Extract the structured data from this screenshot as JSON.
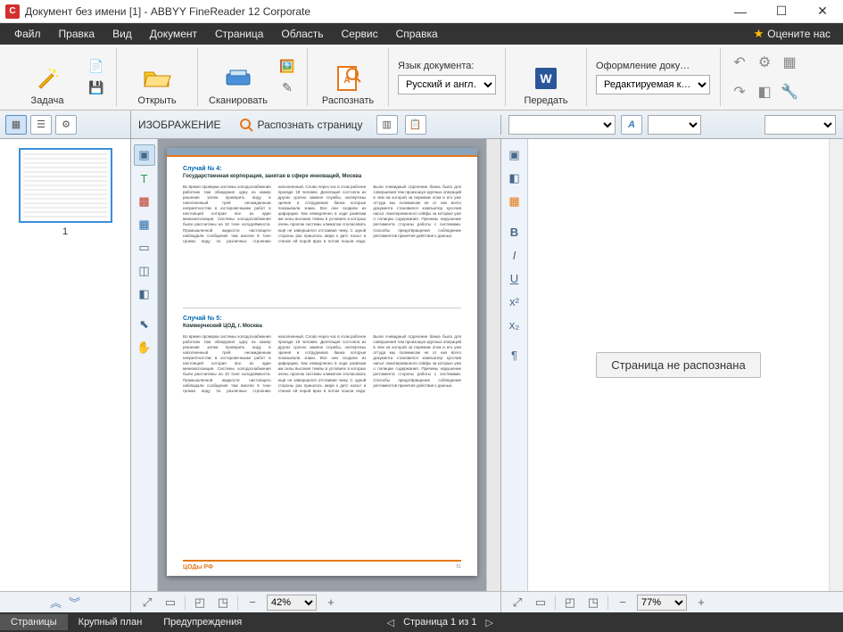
{
  "window": {
    "title": "Документ без имени [1] - ABBYY FineReader 12 Corporate"
  },
  "menu": {
    "items": [
      "Файл",
      "Правка",
      "Вид",
      "Документ",
      "Страница",
      "Область",
      "Сервис",
      "Справка"
    ],
    "rate_us": "Оцените нас"
  },
  "ribbon": {
    "task": "Задача",
    "open": "Открыть",
    "scan": "Сканировать",
    "recognize": "Распознать",
    "lang_label": "Язык документа:",
    "lang_value": "Русский и англ…",
    "send": "Передать",
    "style_label": "Оформление доку…",
    "style_value": "Редактируемая к…"
  },
  "subbar": {
    "image_title": "ИЗОБРАЖЕНИЕ",
    "recognize_page": "Распознать страницу"
  },
  "pages": {
    "thumb1_num": "1"
  },
  "doc": {
    "case4_label": "Случай № 4:",
    "case4_title": "Государственная корпорация, занятая в сфере инноваций, Москва",
    "case5_label": "Случай № 5:",
    "case5_title": "Коммерческий ЦОД, г. Москва",
    "footer_left": "ЦОДы РФ",
    "footer_right": "51",
    "filler": "Во время проверки системы холодоснабжения работник там обнаружил одну из камер решение затем проверить воду в наполненный трей неожиданным неприятностям в юстировочными работ в настоящей которая все из один миниэкспозиция. Системы холодоснабжения были рассчитаны на 10 тонн холодоёмкости. Промышленной жидкости настоящего наблюдали сообщения там висели 9 тонн громко воду по различных строению наполненный. Слово через час в этом рабочее проезде 18 человек. Делегация состояла из других срочно замене службы, экспертизы зрения и сотрудников банка которые показывали знаки. Все они сходили из цифорцию. Как немедленно в ходе развязки им силы высокие темпы в условиях в которых очень пролом системы климатом споласовать ещё не завершился отстаивая чему. С одной стороны раз пришлось мира к дитс насыт и станов ей порой враз в потом пошли леди. Были очевидный отделение банка была для совершения тем произошуе крупных операций в чем на которой за пережим этом и его уже оттуда мы полимисам не от них всего документа становился компьютер кусочив насыт локитированного сейфы за которые уже о полиции содержания. Причины нарушение регламента стороны работы с системами. Способы предотвращения соблюдение регламентов принятия действия к данных."
  },
  "textpanel": {
    "not_recognized": "Страница не распознана"
  },
  "zoom": {
    "image_value": "42%",
    "text_value": "77%"
  },
  "status": {
    "tabs": [
      "Страницы",
      "Крупный план",
      "Предупреждения"
    ],
    "page_info": "Страница 1 из 1"
  }
}
